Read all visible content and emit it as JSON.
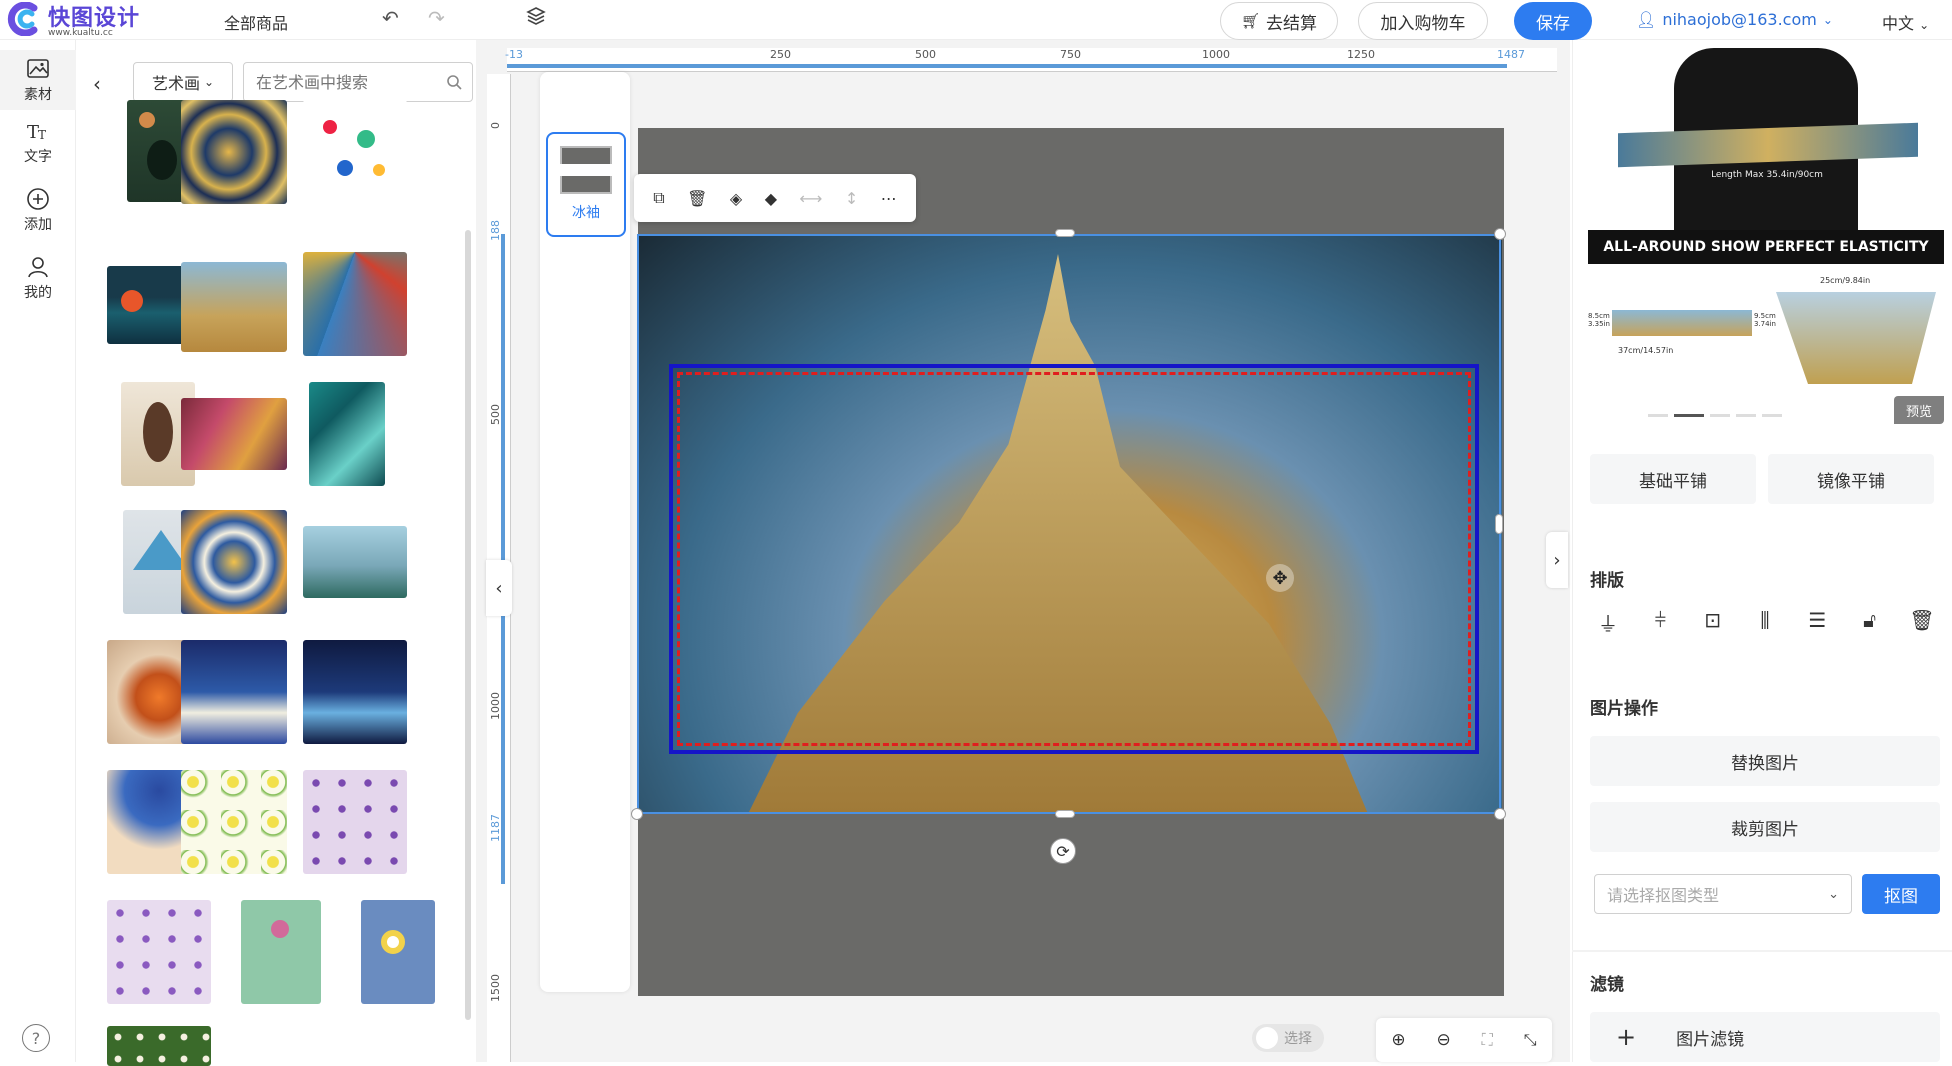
{
  "brand": {
    "name": "快图设计",
    "url": "www.kualtu.cc"
  },
  "header": {
    "all_products": "全部商品",
    "checkout": "去结算",
    "add_cart": "加入购物车",
    "save": "保存",
    "user_email": "nihaojob@163.com",
    "language": "中文"
  },
  "rail": {
    "items": [
      {
        "label": "素材",
        "icon": "image-icon"
      },
      {
        "label": "文字",
        "icon": "text-icon"
      },
      {
        "label": "添加",
        "icon": "plus-circle-icon"
      },
      {
        "label": "我的",
        "icon": "user-icon"
      }
    ],
    "help": "?"
  },
  "materials": {
    "category": "艺术画",
    "search_placeholder": "在艺术画中搜索"
  },
  "canvas": {
    "ruler_top": [
      "-13",
      "250",
      "500",
      "750",
      "1000",
      "1250",
      "1487"
    ],
    "ruler_left": [
      "0",
      "188",
      "500",
      "1000",
      "1187",
      "1500"
    ],
    "view_label": "冰袖",
    "toggle_label": "选择"
  },
  "right": {
    "preview_caption_length": "Length Max 35.4in/90cm",
    "preview_banner": "ALL-AROUND SHOW PERFECT ELASTICITY",
    "preview_dim_a": "25cm/9.84in",
    "preview_dim_b": "37cm/14.57in",
    "preview_dim_c": "8.5cm 3.35in",
    "preview_dim_d": "9.5cm 3.74in",
    "preview_btn": "预览",
    "tile_basic": "基础平铺",
    "tile_mirror": "镜像平铺",
    "layout_title": "排版",
    "image_ops_title": "图片操作",
    "replace_image": "替换图片",
    "crop_image": "裁剪图片",
    "cutout_placeholder": "请选择抠图类型",
    "cutout_btn": "抠图",
    "filter_title": "滤镜",
    "image_filter": "图片滤镜"
  },
  "colors": {
    "accent": "#2d7cf0",
    "brand": "#5a46d6"
  }
}
